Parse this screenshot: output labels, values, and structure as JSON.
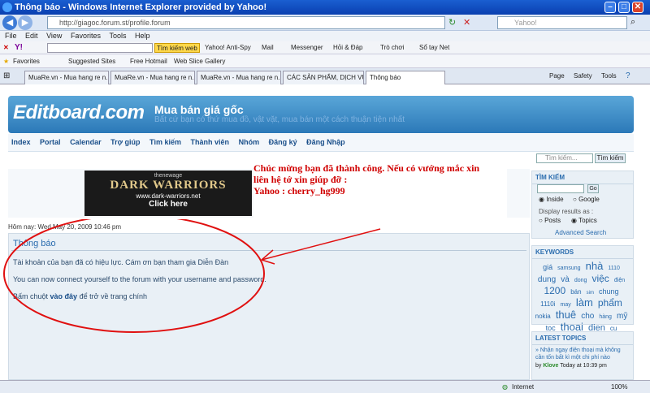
{
  "window": {
    "title": "Thông báo - Windows Internet Explorer provided by Yahoo!",
    "address": "http://giagoc.forum.st/profile.forum",
    "yahoo_search_placeholder": "Yahoo!"
  },
  "menu": [
    "File",
    "Edit",
    "View",
    "Favorites",
    "Tools",
    "Help"
  ],
  "yahoo_toolbar": {
    "search_btn": "Tìm kiếm web",
    "items": [
      "Yahoo! Anti-Spy",
      "Mail",
      "Messenger",
      "Hỏi & Đáp",
      "Trò chơi",
      "Sổ tay Net"
    ]
  },
  "favorites_bar": {
    "label": "Favorites",
    "items": [
      "Suggested Sites",
      "Free Hotmail",
      "Web Slice Gallery"
    ]
  },
  "tabs": [
    "MuaRe.vn - Mua hang re n...",
    "MuaRe.vn - Mua hang re n...",
    "MuaRe.vn - Mua hang re n...",
    "CÁC SẢN PHẨM, DỊCH VỤ ...",
    "Thông báo"
  ],
  "tab_tools": [
    "Page",
    "Safety",
    "Tools"
  ],
  "site": {
    "logo": "Editboard.com",
    "title": "Mua bán giá gốc",
    "description": "Bất cứ bạn có thứ mua đồ, vật vặt, mua bán một cách thuận tiện nhất",
    "nav": [
      "Index",
      "Portal",
      "Calendar",
      "Trợ giúp",
      "Tìm kiếm",
      "Thành viên",
      "Nhóm",
      "Đăng ký",
      "Đăng Nhập"
    ],
    "top_search_placeholder": "Tìm kiếm...",
    "top_search_btn": "Tìm kiếm"
  },
  "ad": {
    "line1": "thenewage",
    "line2": "DARK WARRIORS",
    "line3": "www.dark-warriors.net",
    "line4": "Click here"
  },
  "note": {
    "line1": "Chúc mừng bạn đã thành công. Nếu có vướng mắc xin",
    "line2": "liên hệ tớ xin giúp đỡ :",
    "line3": "Yahoo : cherry_hg999"
  },
  "date_text": "Hôm nay: Wed May 20, 2009 10:46 pm",
  "info": {
    "title": "Thông báo",
    "msg1": "Tài khoản của bạn đã có hiệu lực. Cám ơn bạn tham gia Diễn Đàn",
    "msg2": "You can now connect yourself to the forum with your username and password.",
    "msg3_prefix": "Bấm chuột",
    "msg3_link": "vào đây",
    "msg3_suffix": "để trở về trang chính"
  },
  "sidebar": {
    "search": {
      "title": "TÌM KIẾM",
      "go": "Go",
      "inside": "Inside",
      "google": "Google",
      "display": "Display results as :",
      "posts": "Posts",
      "topics": "Topics",
      "advanced": "Advanced Search"
    },
    "keywords": {
      "title": "KEYWORDS",
      "words": [
        "giá",
        "samsung",
        "nhà",
        "1110",
        "dung",
        "và",
        "dong",
        "việc",
        "điện",
        "1200",
        "bán",
        "sim",
        "chung",
        "1110i",
        "may",
        "làm",
        "phẩm",
        "nokia",
        "thuê",
        "cho",
        "hàng",
        "mỹ",
        "toc",
        "thoai",
        "dien",
        "cu"
      ]
    },
    "latest": {
      "title": "LATEST TOPICS",
      "item": "» Nhận ngay điện thoại mà không cần tốn bất kì một chi phí nào",
      "by": "by",
      "user": "Klove",
      "when": "Today at 10:39 pm"
    }
  },
  "status": {
    "zone": "Internet",
    "zoom": "100%"
  }
}
